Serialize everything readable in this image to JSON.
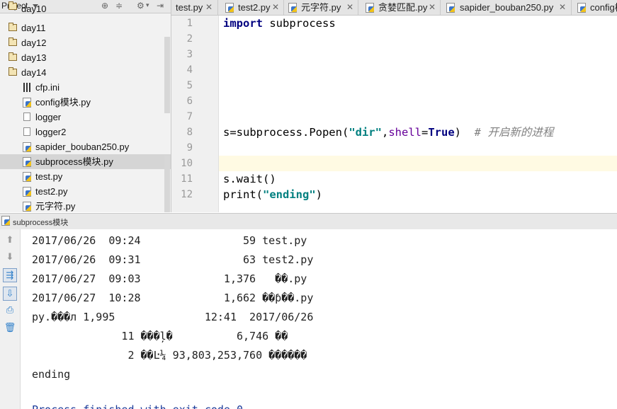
{
  "project_panel": {
    "title": "Project",
    "tree": [
      {
        "label": "day10",
        "kind": "folder"
      },
      {
        "label": "day11",
        "kind": "folder"
      },
      {
        "label": "day12",
        "kind": "folder"
      },
      {
        "label": "day13",
        "kind": "folder"
      },
      {
        "label": "day14",
        "kind": "folder"
      },
      {
        "label": "cfp.ini",
        "kind": "ini"
      },
      {
        "label": "config模块.py",
        "kind": "py"
      },
      {
        "label": "logger",
        "kind": "file"
      },
      {
        "label": "logger2",
        "kind": "file"
      },
      {
        "label": "sapider_bouban250.py",
        "kind": "py"
      },
      {
        "label": "subprocess模块.py",
        "kind": "py",
        "selected": true
      },
      {
        "label": "test.py",
        "kind": "py"
      },
      {
        "label": "test2.py",
        "kind": "py"
      },
      {
        "label": "元字符.py",
        "kind": "py"
      }
    ]
  },
  "tabs": [
    {
      "label": "test.py"
    },
    {
      "label": "test2.py"
    },
    {
      "label": "元字符.py"
    },
    {
      "label": "贪婪匹配.py"
    },
    {
      "label": "sapider_bouban250.py"
    },
    {
      "label": "config模"
    }
  ],
  "editor": {
    "line_numbers": [
      "1",
      "2",
      "3",
      "4",
      "5",
      "6",
      "7",
      "8",
      "9",
      "10",
      "11",
      "12"
    ],
    "code": {
      "l1_kw": "import",
      "l1_rest": " subprocess",
      "l8_a": "s=subprocess.Popen(",
      "l8_str": "\"dir\"",
      "l8_b": ",",
      "l8_kwarg": "shell",
      "l8_c": "=",
      "l8_true": "True",
      "l8_d": ")  ",
      "l8_comment": "# 开启新的进程",
      "l11": "s.wait()",
      "l12_a": "print(",
      "l12_str": "\"ending\"",
      "l12_b": ")"
    }
  },
  "run_panel": {
    "title": "subprocess模块",
    "output": [
      "2017/06/26  09:24                59 test.py",
      "2017/06/26  09:31                63 test2.py",
      "2017/06/27  09:03             1,376   ��.py",
      "2017/06/27  10:28             1,662 ��ƥ��.py",
      "py.���л 1,995              12:41  2017/06/26",
      "              11 ���ļ�          6,746 ��",
      "               2 ��Ŀ¼ 93,803,253,760 ������",
      "ending",
      "",
      "Process finished with exit code 0"
    ]
  }
}
